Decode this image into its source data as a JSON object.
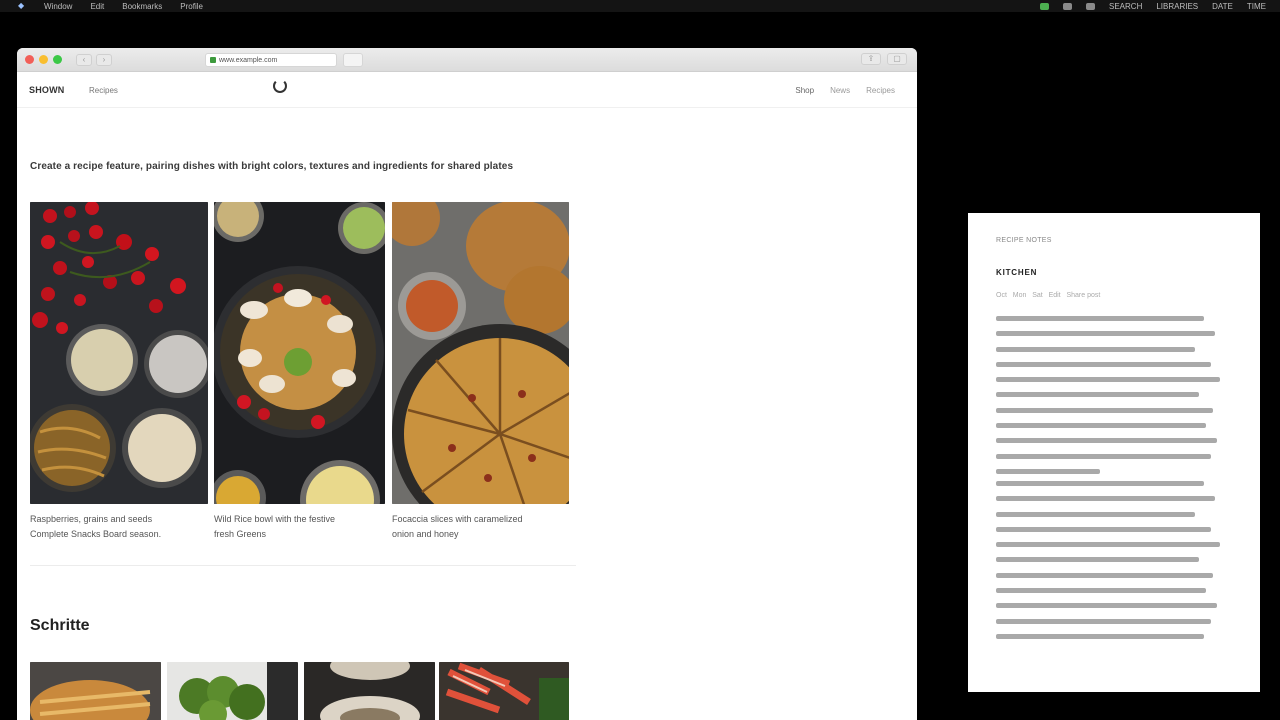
{
  "menubar": {
    "items": [
      "Window",
      "Edit",
      "Bookmarks",
      "Profile"
    ],
    "right_items": [
      "SEARCH",
      "LIBRARIES",
      "DATE",
      "TIME"
    ]
  },
  "browser": {
    "url": "www.example.com",
    "back_label": "‹",
    "forward_label": "›"
  },
  "site": {
    "logo": "SHOWN",
    "header_link": "Recipes",
    "nav": [
      "Shop",
      "News",
      "Recipes"
    ]
  },
  "article": {
    "headline": "Create a recipe feature, pairing dishes with bright colors, textures and ingredients for shared plates",
    "captions": [
      [
        "Raspberries, grains and seeds",
        "Complete Snacks Board season."
      ],
      [
        "Wild Rice bowl with the festive",
        "fresh Greens"
      ],
      [
        "Focaccia slices with caramelized",
        "onion and honey"
      ]
    ],
    "section_title": "Schritte"
  },
  "side_panel": {
    "label": "RECIPE NOTES",
    "title": "KITCHEN",
    "meta": [
      "Oct",
      "Mon",
      "Sat",
      "Edit",
      "Share post"
    ],
    "paragraph_lines": [
      11,
      11
    ]
  },
  "colors": {
    "menubar_bg": "#141414",
    "window_bg": "#ffffff",
    "backdrop": "#000000"
  }
}
